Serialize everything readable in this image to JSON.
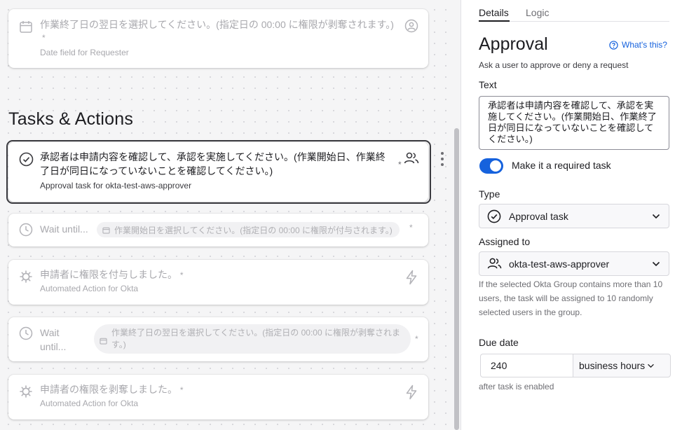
{
  "canvas": {
    "card1": {
      "title": "作業終了日の翌日を選択してください。(指定日の 00:00 に権限が剥奪されます。)",
      "required_mark": "*",
      "subtitle": "Date field for Requester"
    },
    "section_title": "Tasks & Actions",
    "approval_card": {
      "title": "承認者は申請内容を確認して、承認を実施してください。(作業開始日、作業終了日が同日になっていないことを確認してください。)",
      "required_mark": "*",
      "subtitle": "Approval task for okta-test-aws-approver"
    },
    "wait_card1": {
      "label": "Wait until...",
      "pill": "作業開始日を選択してください。(指定日の 00:00 に権限が付与されます。)",
      "required_mark": "*"
    },
    "action_card1": {
      "title": "申請者に権限を付与しました。",
      "required_mark": "*",
      "subtitle": "Automated Action for Okta"
    },
    "wait_card2": {
      "label_line1": "Wait",
      "label_line2": "until...",
      "pill_line1": "作業終了日の翌日を選択してください。(指定日の 00:00 に権限が剥奪されま",
      "pill_line2": "す。)",
      "required_mark": "*"
    },
    "action_card2": {
      "title": "申請者の権限を剥奪しました。",
      "required_mark": "*",
      "subtitle": "Automated Action for Okta"
    }
  },
  "panel": {
    "tabs": [
      {
        "label": "Details",
        "active": true
      },
      {
        "label": "Logic",
        "active": false
      }
    ],
    "title": "Approval",
    "whats_this": "What's this?",
    "description": "Ask a user to approve or deny a request",
    "text_label": "Text",
    "text_value": "承認者は申請内容を確認して、承認を実施してください。(作業開始日、作業終了日が同日になっていないことを確認してください。)",
    "required_toggle": {
      "label": "Make it a required task",
      "on": true
    },
    "type_label": "Type",
    "type_value": "Approval task",
    "assigned_label": "Assigned to",
    "assigned_value": "okta-test-aws-approver",
    "assigned_hint": "If the selected Okta Group contains more than 10 users, the task will be assigned to 10 randomly selected users in the group.",
    "due_label": "Due date",
    "due_value": "240",
    "due_unit": "business hours",
    "due_hint": "after task is enabled"
  },
  "colors": {
    "accent": "#1662dd",
    "text": "#1d1d21",
    "muted": "#a8a8ad",
    "selected_border": "#3b3b40"
  },
  "icons": {
    "calendar": "calendar-icon",
    "user_circle": "user-circle-icon",
    "approval": "check-circle-icon",
    "group": "group-icon",
    "clock": "clock-icon",
    "gear": "gear-icon",
    "bolt": "lightning-icon",
    "help": "help-circle-icon",
    "chevron": "chevron-down-icon",
    "kebab": "kebab-menu-icon"
  }
}
